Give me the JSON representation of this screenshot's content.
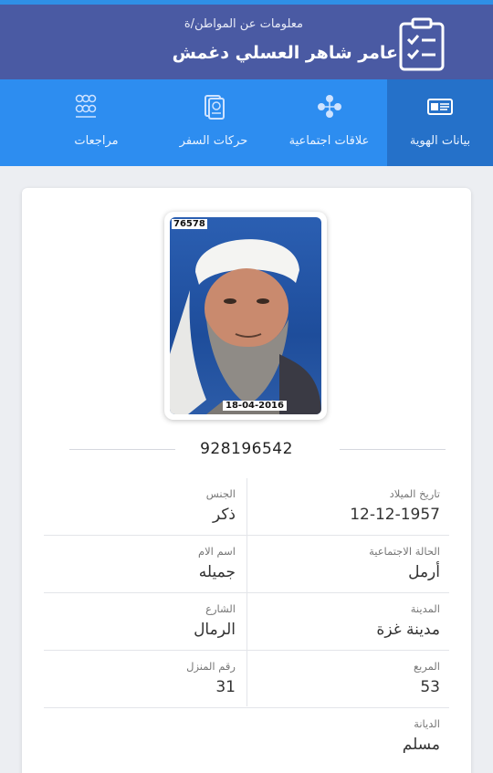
{
  "header": {
    "subtitle": "معلومات عن المواطن/ة",
    "name": "عامر شاهر العسلي دغمش"
  },
  "tabs": [
    {
      "label": "بيانات الهوية",
      "icon": "id-card-icon",
      "active": true
    },
    {
      "label": "علاقات اجتماعية",
      "icon": "people-network-icon",
      "active": false
    },
    {
      "label": "حركات السفر",
      "icon": "passport-icon",
      "active": false
    },
    {
      "label": "مراجعات",
      "icon": "group-icon",
      "active": false
    }
  ],
  "photo": {
    "serial": "76578",
    "date": "18-04-2016"
  },
  "id_number": "928196542",
  "fields": {
    "birth_date": {
      "label": "تاريخ الميلاد",
      "value": "12-12-1957"
    },
    "gender": {
      "label": "الجنس",
      "value": "ذكر"
    },
    "marital_status": {
      "label": "الحالة الاجتماعية",
      "value": "أرمل"
    },
    "mother_name": {
      "label": "اسم الام",
      "value": "جميله"
    },
    "city": {
      "label": "المدينة",
      "value": "مدينة غزة"
    },
    "street": {
      "label": "الشارع",
      "value": "الرمال"
    },
    "block": {
      "label": "المربع",
      "value": "53"
    },
    "house_number": {
      "label": "رقم المنزل",
      "value": "31"
    },
    "religion": {
      "label": "الديانة",
      "value": "مسلم"
    }
  },
  "colors": {
    "header_bg": "#4a5aa3",
    "tabs_bg": "#2d8df0",
    "active_tab_bg": "#2571c9"
  }
}
